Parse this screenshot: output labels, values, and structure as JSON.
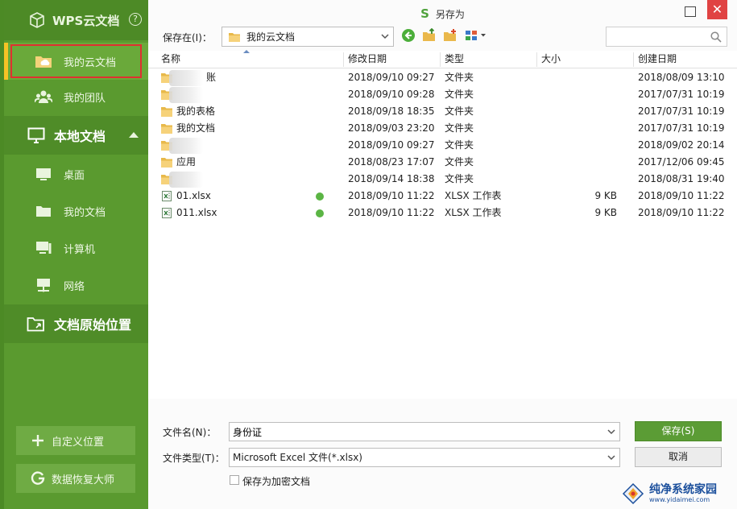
{
  "sidebar": {
    "brand": "WPS云文档",
    "help_glyph": "?",
    "cloud_items": [
      {
        "label": "我的云文档",
        "icon": "cloud-folder-icon",
        "active": true
      },
      {
        "label": "我的团队",
        "icon": "team-icon",
        "active": false
      }
    ],
    "local_section": "本地文档",
    "local_items": [
      {
        "label": "桌面",
        "icon": "desktop-icon"
      },
      {
        "label": "我的文档",
        "icon": "folder-icon"
      },
      {
        "label": "计算机",
        "icon": "computer-icon"
      },
      {
        "label": "网络",
        "icon": "network-icon"
      }
    ],
    "origin_section": "文档原始位置",
    "custom_location_btn": "自定义位置",
    "recovery_btn": "数据恢复大师"
  },
  "dialog": {
    "title": "另存为",
    "title_logo": "S",
    "save_in_label": "保存在(I)：",
    "save_in_value": "我的云文档",
    "search_placeholder": "",
    "columns": {
      "name": "名称",
      "modified": "修改日期",
      "type": "类型",
      "size": "大小",
      "created": "创建日期"
    },
    "rows": [
      {
        "name": "账",
        "modified": "2018/09/10 09:27",
        "type": "文件夹",
        "size": "",
        "created": "2018/08/09 13:10",
        "kind": "folder",
        "blurred": true,
        "synced": false
      },
      {
        "name": "",
        "modified": "2018/09/10 09:28",
        "type": "文件夹",
        "size": "",
        "created": "2017/07/31 10:19",
        "kind": "folder",
        "blurred": true,
        "synced": false
      },
      {
        "name": "我的表格",
        "modified": "2018/09/18 18:35",
        "type": "文件夹",
        "size": "",
        "created": "2017/07/31 10:19",
        "kind": "folder",
        "blurred": false,
        "synced": false
      },
      {
        "name": "我的文档",
        "modified": "2018/09/03 23:20",
        "type": "文件夹",
        "size": "",
        "created": "2017/07/31 10:19",
        "kind": "folder",
        "blurred": false,
        "synced": false
      },
      {
        "name": "",
        "modified": "2018/09/10 09:27",
        "type": "文件夹",
        "size": "",
        "created": "2018/09/02 20:14",
        "kind": "folder",
        "blurred": true,
        "synced": false
      },
      {
        "name": "应用",
        "modified": "2018/08/23 17:07",
        "type": "文件夹",
        "size": "",
        "created": "2017/12/06 09:45",
        "kind": "folder",
        "blurred": false,
        "synced": false
      },
      {
        "name": "",
        "modified": "2018/09/14 18:38",
        "type": "文件夹",
        "size": "",
        "created": "2018/08/31 19:40",
        "kind": "folder",
        "blurred": true,
        "synced": false
      },
      {
        "name": "01.xlsx",
        "modified": "2018/09/10 11:22",
        "type": "XLSX 工作表",
        "size": "9 KB",
        "created": "2018/09/10 11:22",
        "kind": "xlsx",
        "blurred": false,
        "synced": true
      },
      {
        "name": "011.xlsx",
        "modified": "2018/09/10 11:22",
        "type": "XLSX 工作表",
        "size": "9 KB",
        "created": "2018/09/10 11:22",
        "kind": "xlsx",
        "blurred": false,
        "synced": true
      }
    ],
    "filename_label": "文件名(N)：",
    "filename_value": "身份证",
    "filetype_label": "文件类型(T)：",
    "filetype_value": "Microsoft Excel 文件(*.xlsx)",
    "save_btn": "保存(S)",
    "cancel_btn": "取消",
    "encrypt_label": "保存为加密文档",
    "encrypt_checked": false
  },
  "watermark": {
    "main": "纯净系统家园",
    "sub": "www.yidaimei.com"
  },
  "colors": {
    "sidebar_green": "#5a9a2f",
    "active_bar": "#f6c325",
    "save_green": "#5b9c35",
    "close_red": "#e04343",
    "highlight_box": "#e03030"
  }
}
